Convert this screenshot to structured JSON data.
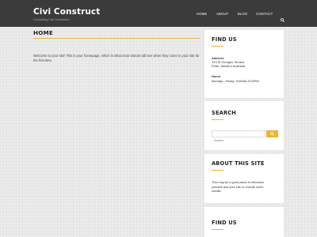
{
  "header": {
    "site_title": "Civi Construct",
    "tagline": "Connecting Civil Contractors",
    "nav": [
      "HOME",
      "ABOUT",
      "BLOG",
      "CONTACT"
    ]
  },
  "main": {
    "title": "HOME",
    "intro": "Welcome to your site! This is your homepage, which is what most visitors will see when they come to your site for the first time."
  },
  "sidebar": {
    "find_us": {
      "title": "FIND US",
      "address_label": "Address",
      "address_line1": "123 St Georges Terrace",
      "address_line2": "Perth, Western Australia",
      "hours_label": "Hours",
      "hours_value": "Monday—Friday: 8:00AM–5:00PM"
    },
    "search": {
      "title": "SEARCH",
      "placeholder": "Search"
    },
    "about": {
      "title": "ABOUT THIS SITE",
      "text_line1": "This may be a good place to introduce",
      "text_line2": "yourself and your site or include some",
      "text_line3": "credits."
    },
    "find_us_2": {
      "title": "FIND US"
    }
  },
  "colors": {
    "header_bg": "#3b3b3b",
    "accent": "#f0b429",
    "page_bg": "#ececec"
  },
  "icons": {
    "header_search": "search-icon",
    "widget_search": "search-icon"
  }
}
